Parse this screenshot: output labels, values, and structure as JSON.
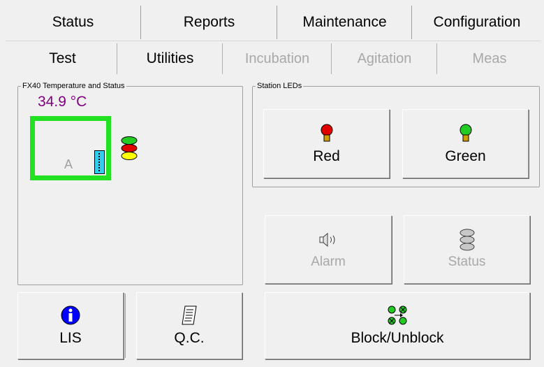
{
  "top_tabs": [
    "Status",
    "Reports",
    "Maintenance",
    "Configuration"
  ],
  "sub_tabs": [
    {
      "label": "Test",
      "enabled": true
    },
    {
      "label": "Utilities",
      "enabled": true
    },
    {
      "label": "Incubation",
      "enabled": false
    },
    {
      "label": "Agitation",
      "enabled": false
    },
    {
      "label": "Meas",
      "enabled": false
    }
  ],
  "fx40": {
    "group_title": "FX40 Temperature and Status",
    "temperature": "34.9 °C",
    "slot_label": "A"
  },
  "station_leds": {
    "group_title": "Station LEDs",
    "red_label": "Red",
    "green_label": "Green"
  },
  "actions": {
    "alarm_label": "Alarm",
    "status_label": "Status",
    "lis_label": "LIS",
    "qc_label": "Q.C.",
    "block_label": "Block/Unblock"
  },
  "colors": {
    "accent_green": "#22e022",
    "temperature_text": "#800080",
    "led_red": "#e00000",
    "led_green": "#22cc22",
    "led_yellow": "#ffff00",
    "info_blue": "#0000ff"
  },
  "icons": [
    "red-led-icon",
    "green-led-icon",
    "speaker-icon",
    "status-stack-icon",
    "info-icon",
    "report-icon",
    "block-unblock-icon",
    "status-light-icon"
  ]
}
